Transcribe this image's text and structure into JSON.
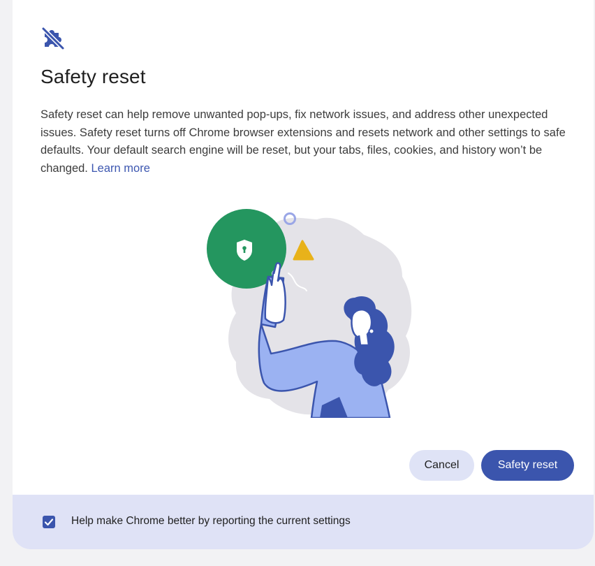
{
  "dialog": {
    "icon": "puzzle-piece-off-icon",
    "title": "Safety reset",
    "description": "Safety reset can help remove unwanted pop-ups, fix network issues, and address other unexpected issues. Safety reset turns off Chrome browser extensions and resets network and other settings to safe defaults. Your default search engine will be reset, but your tabs, files, cookies, and history won’t be changed.",
    "learn_more_label": "Learn more",
    "illustration": "person-pointing-shield-illustration"
  },
  "actions": {
    "cancel_label": "Cancel",
    "confirm_label": "Safety reset"
  },
  "footer": {
    "checkbox_checked": true,
    "checkbox_label": "Help make Chrome better by reporting the current settings"
  },
  "colors": {
    "accent": "#3b55ad",
    "tonal_button": "#dfe3f6",
    "footer_bg": "#dfe2f6",
    "shield_green": "#24965f",
    "triangle_yellow": "#e8b21a",
    "figure_blue": "#9bb2f2"
  }
}
